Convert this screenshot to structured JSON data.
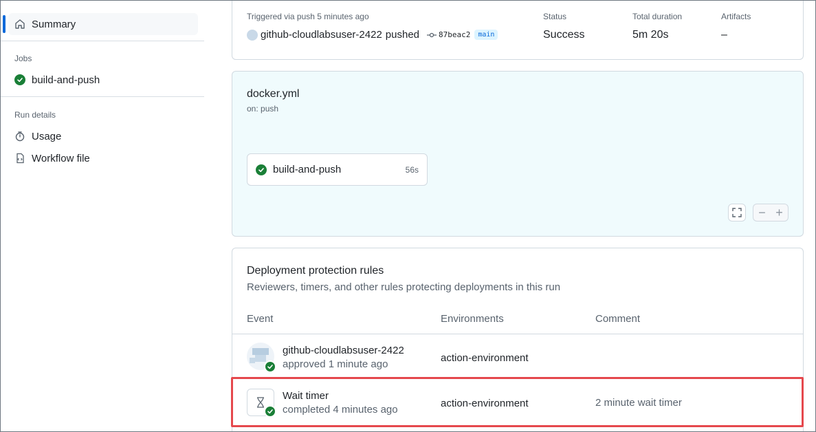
{
  "sidebar": {
    "summary_label": "Summary",
    "jobs_heading": "Jobs",
    "job_label": "build-and-push",
    "run_details_heading": "Run details",
    "usage_label": "Usage",
    "workflow_file_label": "Workflow file"
  },
  "run_summary": {
    "trigger_text": "Triggered via push 5 minutes ago",
    "actor": "github-cloudlabsuser-2422",
    "action": "pushed",
    "commit": "87beac2",
    "branch": "main",
    "status_label": "Status",
    "status_value": "Success",
    "duration_label": "Total duration",
    "duration_value": "5m 20s",
    "artifacts_label": "Artifacts",
    "artifacts_value": "–"
  },
  "workflow": {
    "file": "docker.yml",
    "trigger": "on: push",
    "job_name": "build-and-push",
    "job_duration": "56s"
  },
  "protection": {
    "title": "Deployment protection rules",
    "subtitle": "Reviewers, timers, and other rules protecting deployments in this run",
    "columns": [
      "Event",
      "Environments",
      "Comment"
    ],
    "rows": [
      {
        "name": "github-cloudlabsuser-2422",
        "detail": "approved 1 minute ago",
        "environment": "action-environment",
        "comment": ""
      },
      {
        "name": "Wait timer",
        "detail": "completed 4 minutes ago",
        "environment": "action-environment",
        "comment": "2 minute wait timer"
      }
    ]
  },
  "colors": {
    "success": "#1a7f37",
    "accent": "#0969da",
    "highlight": "#e5484d",
    "graph_bg": "#f0fbfd"
  }
}
